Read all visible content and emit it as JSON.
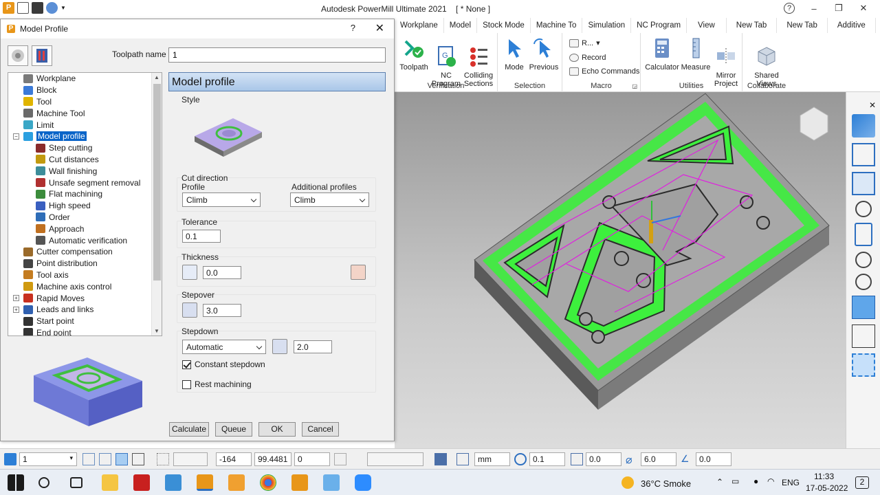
{
  "app": {
    "title": "Autodesk PowerMill Ultimate 2021",
    "project": "[ * None ]",
    "window_controls": [
      "?",
      "–",
      "❐",
      "✕"
    ]
  },
  "ribbon": {
    "tabs": [
      "Workplane",
      "Model",
      "Stock Mode",
      "Machine To",
      "Simulation",
      "NC Program",
      "View",
      "New Tab",
      "New Tab",
      "Additive"
    ],
    "groups": {
      "verification": {
        "label": "Verification",
        "buttons": [
          "Toolpath",
          "NC\nProgram",
          "Colliding\nSections"
        ]
      },
      "selection": {
        "label": "Selection",
        "buttons": [
          "Mode",
          "Previous"
        ]
      },
      "macro": {
        "label": "Macro",
        "items": [
          "R...",
          "Record",
          "Echo Commands"
        ]
      },
      "utilities": {
        "label": "Utilities",
        "buttons": [
          "Calculator",
          "Measure",
          "Mirror\nProject"
        ]
      },
      "collaborate": {
        "label": "Collaborate",
        "buttons": [
          "Shared\nViews"
        ]
      }
    }
  },
  "dialog": {
    "title": "Model Profile",
    "help": "?",
    "close": "✕",
    "toolpath_name_label": "Toolpath name",
    "toolpath_name_value": "1",
    "tree": [
      {
        "label": "Workplane",
        "indent": 0,
        "icon_color": "#7a7a7a"
      },
      {
        "label": "Block",
        "indent": 0,
        "icon_color": "#3b7ad8"
      },
      {
        "label": "Tool",
        "indent": 0,
        "icon_color": "#e0b400"
      },
      {
        "label": "Machine Tool",
        "indent": 0,
        "icon_color": "#6a6a6a"
      },
      {
        "label": "Limit",
        "indent": 0,
        "icon_color": "#3aa7c6"
      },
      {
        "label": "Model profile",
        "indent": 0,
        "icon_color": "#2ba0e0",
        "selected": true,
        "expand": "−"
      },
      {
        "label": "Step cutting",
        "indent": 1,
        "icon_color": "#8a2b2b"
      },
      {
        "label": "Cut distances",
        "indent": 1,
        "icon_color": "#c29a10"
      },
      {
        "label": "Wall finishing",
        "indent": 1,
        "icon_color": "#3d8d9a"
      },
      {
        "label": "Unsafe segment removal",
        "indent": 1,
        "icon_color": "#b03030"
      },
      {
        "label": "Flat machining",
        "indent": 1,
        "icon_color": "#3c8c3c"
      },
      {
        "label": "High speed",
        "indent": 1,
        "icon_color": "#3a5fc0"
      },
      {
        "label": "Order",
        "indent": 1,
        "icon_color": "#2e6db8"
      },
      {
        "label": "Approach",
        "indent": 1,
        "icon_color": "#c07020"
      },
      {
        "label": "Automatic verification",
        "indent": 1,
        "icon_color": "#555555"
      },
      {
        "label": "Cutter compensation",
        "indent": 0,
        "icon_color": "#9a6a2a"
      },
      {
        "label": "Point distribution",
        "indent": 0,
        "icon_color": "#444444"
      },
      {
        "label": "Tool axis",
        "indent": 0,
        "icon_color": "#c47c20"
      },
      {
        "label": "Machine axis control",
        "indent": 0,
        "icon_color": "#d09a10"
      },
      {
        "label": "Rapid Moves",
        "indent": 0,
        "icon_color": "#c83020",
        "expand": "+"
      },
      {
        "label": "Leads and links",
        "indent": 0,
        "icon_color": "#3060b0",
        "expand": "+"
      },
      {
        "label": "Start point",
        "indent": 0,
        "icon_color": "#333333"
      },
      {
        "label": "End point",
        "indent": 0,
        "icon_color": "#333333"
      }
    ],
    "pane_title": "Model profile",
    "style_label": "Style",
    "cut_direction": {
      "label": "Cut direction",
      "profile_label": "Profile",
      "profile_value": "Climb",
      "additional_label": "Additional profiles",
      "additional_value": "Climb"
    },
    "tolerance": {
      "label": "Tolerance",
      "value": "0.1"
    },
    "thickness": {
      "label": "Thickness",
      "value": "0.0"
    },
    "stepover": {
      "label": "Stepover",
      "value": "3.0"
    },
    "stepdown": {
      "label": "Stepdown",
      "mode": "Automatic",
      "value": "2.0"
    },
    "constant_stepdown": {
      "label": "Constant stepdown",
      "checked": true
    },
    "rest_machining": {
      "label": "Rest machining",
      "checked": false
    },
    "buttons": {
      "calculate": "Calculate",
      "queue": "Queue",
      "ok": "OK",
      "cancel": "Cancel"
    }
  },
  "status": {
    "workplane": "1",
    "x": "-164",
    "y": "99.4481",
    "z": "0",
    "units": "mm",
    "tolerance": "0.1",
    "thickness": "0.0",
    "diameter": "6.0",
    "angle": "0.0"
  },
  "taskbar": {
    "weather": "36°C  Smoke",
    "lang": "ENG",
    "time": "11:33",
    "date": "17-05-2022",
    "notifications": "2"
  },
  "colors": {
    "accent_blue": "#0a64c8",
    "toolpath_green": "#3df03d",
    "pane_header": "#a9c6e8",
    "brand_orange": "#e89619"
  }
}
